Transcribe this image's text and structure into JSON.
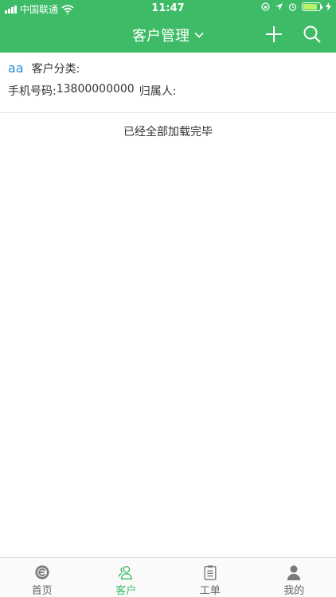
{
  "status_bar": {
    "carrier": "中国联通",
    "time": "11:47",
    "battery_level": 0.85
  },
  "nav": {
    "title": "客户管理",
    "icons": [
      "chevron-down-icon",
      "plus-icon",
      "search-icon"
    ]
  },
  "customers": [
    {
      "name": "aa",
      "category_label": "客户分类:",
      "phone_label": "手机号码:",
      "phone": "13800000000",
      "owner_label": "归属人:"
    }
  ],
  "list_footer": "已经全部加载完毕",
  "tabs": [
    {
      "label": "首页",
      "icon": "home-icon",
      "active": false
    },
    {
      "label": "客户",
      "icon": "customers-icon",
      "active": true
    },
    {
      "label": "工单",
      "icon": "clipboard-icon",
      "active": false
    },
    {
      "label": "我的",
      "icon": "profile-icon",
      "active": false
    }
  ],
  "colors": {
    "brand_green": "#3dbb66",
    "name_blue": "#2a8fd6",
    "inactive_icon": "#7a7a7a"
  }
}
